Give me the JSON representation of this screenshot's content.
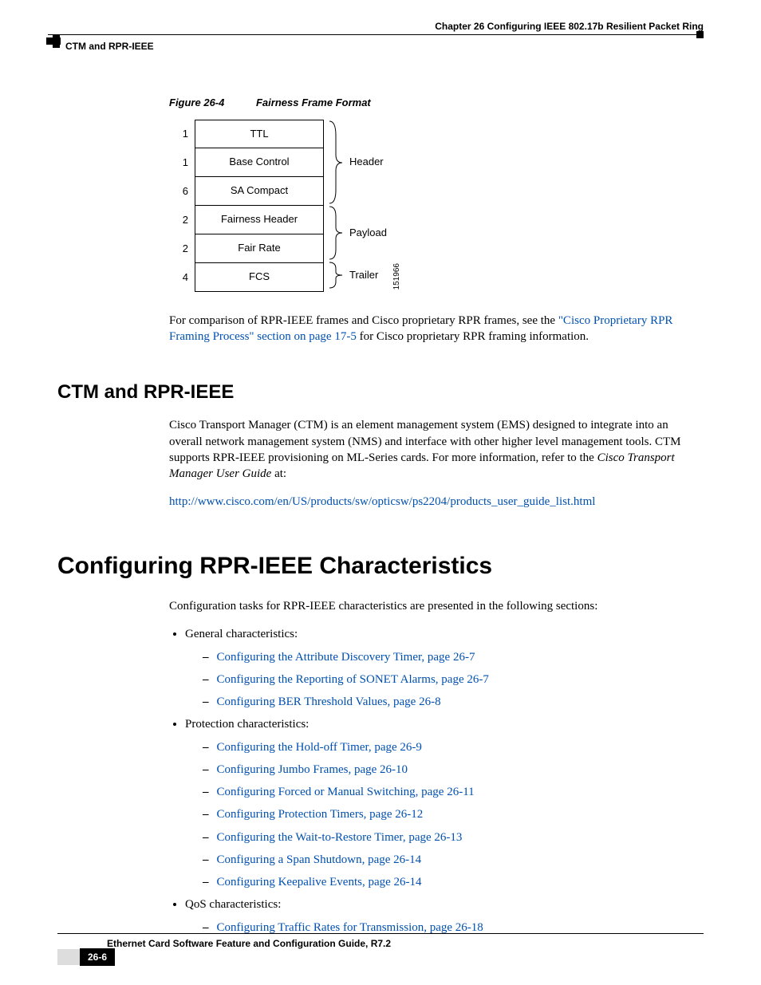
{
  "header": {
    "chapter": "Chapter 26 Configuring IEEE 802.17b Resilient Packet Ring",
    "section": "CTM and RPR-IEEE"
  },
  "figure": {
    "number": "Figure 26-4",
    "title": "Fairness Frame Format",
    "id": "151966",
    "rows": [
      {
        "octets": "1",
        "field": "TTL"
      },
      {
        "octets": "1",
        "field": "Base Control"
      },
      {
        "octets": "6",
        "field": "SA Compact"
      },
      {
        "octets": "2",
        "field": "Fairness Header"
      },
      {
        "octets": "2",
        "field": "Fair Rate"
      },
      {
        "octets": "4",
        "field": "FCS"
      }
    ],
    "braces": {
      "header": "Header",
      "payload": "Payload",
      "trailer": "Trailer"
    }
  },
  "para1": {
    "pre": "For comparison of RPR-IEEE frames and Cisco proprietary RPR frames, see the ",
    "link": "\"Cisco Proprietary RPR Framing Process\" section on page 17-5",
    "post": " for Cisco proprietary RPR framing information."
  },
  "h2": "CTM and RPR-IEEE",
  "ctm": {
    "p1a": "Cisco Transport Manager (CTM) is an element management system (EMS) designed to integrate into an overall network management system (NMS) and interface with other higher level management tools. CTM supports RPR-IEEE provisioning on ML-Series cards. For more information, refer to the ",
    "p1b": "Cisco Transport Manager User Guide",
    "p1c": " at:",
    "url": "http://www.cisco.com/en/US/products/sw/opticsw/ps2204/products_user_guide_list.html"
  },
  "h1": "Configuring RPR-IEEE Characteristics",
  "intro": "Configuration tasks for RPR-IEEE characteristics are presented in the following sections:",
  "lists": {
    "general_label": "General characteristics:",
    "general": [
      "Configuring the Attribute Discovery Timer, page 26-7",
      "Configuring the Reporting of SONET Alarms, page 26-7",
      "Configuring BER Threshold Values, page 26-8"
    ],
    "protection_label": "Protection characteristics:",
    "protection": [
      "Configuring the Hold-off Timer, page 26-9",
      "Configuring Jumbo Frames, page 26-10",
      "Configuring Forced or Manual Switching, page 26-11",
      "Configuring Protection Timers, page 26-12",
      "Configuring the Wait-to-Restore Timer, page 26-13",
      "Configuring a Span Shutdown, page 26-14",
      "Configuring Keepalive Events, page 26-14"
    ],
    "qos_label": "QoS characteristics:",
    "qos": [
      "Configuring Traffic Rates for Transmission, page 26-18"
    ]
  },
  "footer": {
    "title": "Ethernet Card Software Feature and Configuration Guide, R7.2",
    "page": "26-6"
  }
}
